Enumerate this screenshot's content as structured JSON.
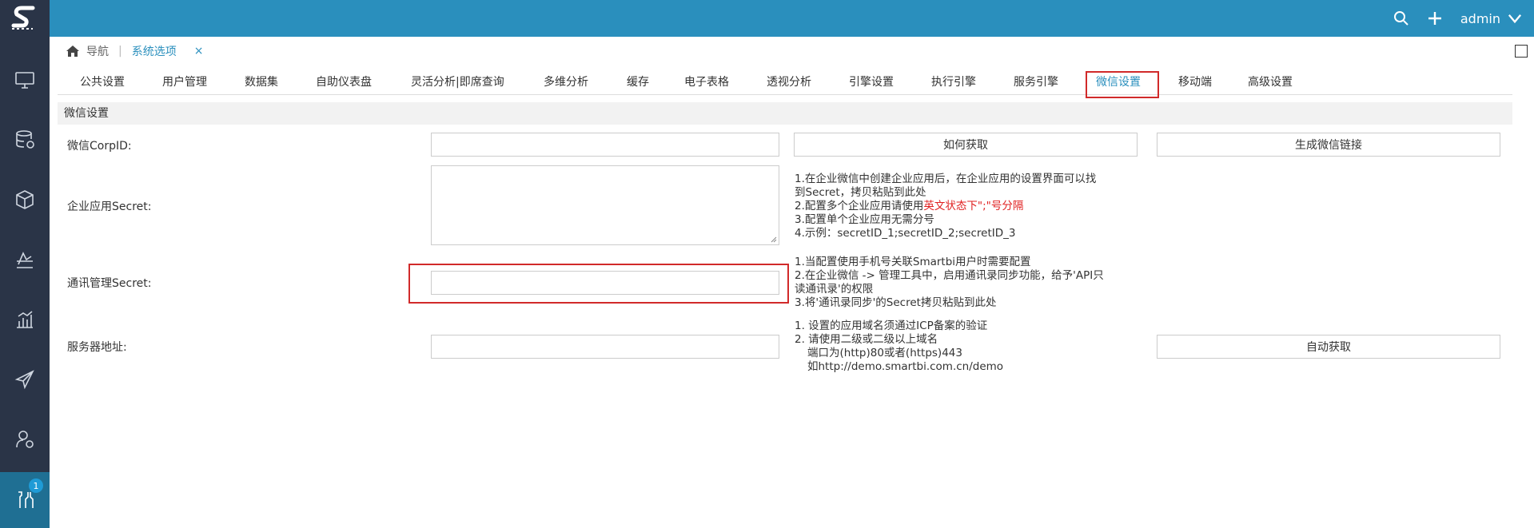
{
  "topbar": {
    "username": "admin"
  },
  "breadcrumb": {
    "home": "导航",
    "current": "系统选项",
    "close": "×"
  },
  "sidebar": {
    "badge": "1"
  },
  "tabs": [
    "公共设置",
    "用户管理",
    "数据集",
    "自助仪表盘",
    "灵活分析|即席查询",
    "多维分析",
    "缓存",
    "电子表格",
    "透视分析",
    "引擎设置",
    "执行引擎",
    "服务引擎",
    "微信设置",
    "移动端",
    "高级设置"
  ],
  "selected_tab": "微信设置",
  "section": {
    "title": "微信设置"
  },
  "form": {
    "corpid_label": "微信CorpID:",
    "how_button": "如何获取",
    "gen_link_button": "生成微信链接",
    "app_secret_label": "企业应用Secret:",
    "app_secret_notes": {
      "line1": "1.在企业微信中创建企业应用后，在企业应用的设置界面可以找",
      "line2": "到Secret，拷贝粘贴到此处",
      "line3_pre": "2.配置多个企业应用请使用",
      "line3_red": "英文状态下\";\"号分隔",
      "line4": "3.配置单个企业应用无需分号",
      "line5": "4.示例：secretID_1;secretID_2;secretID_3"
    },
    "contact_secret_label": "通讯管理Secret:",
    "contact_secret_notes": {
      "line1": "1.当配置使用手机号关联Smartbi用户时需要配置",
      "line2": "2.在企业微信 -> 管理工具中，启用通讯录同步功能，给予'API只",
      "line3": "读通讯录'的权限",
      "line4": "3.将'通讯录同步'的Secret拷贝粘贴到此处"
    },
    "server_label": "服务器地址:",
    "server_notes": {
      "line1": "1. 设置的应用域名须通过ICP备案的验证",
      "line2": "2. 请使用二级或二级以上域名",
      "line3": "端口为(http)80或者(https)443",
      "line4": "如http://demo.smartbi.com.cn/demo"
    },
    "auto_button": "自动获取"
  }
}
